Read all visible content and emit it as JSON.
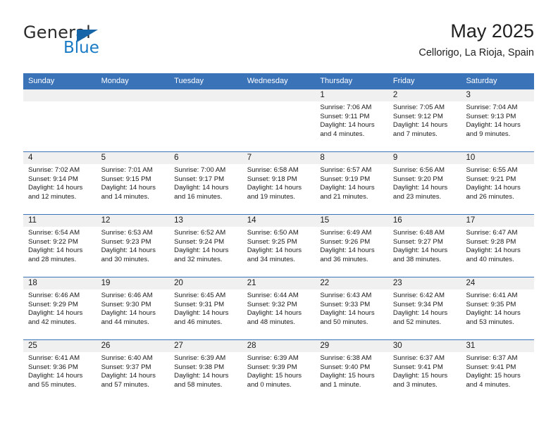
{
  "brand": {
    "name_part1": "General",
    "name_part2": "Blue",
    "flag_icon": "triangle-flag-icon"
  },
  "header": {
    "title": "May 2025",
    "subtitle": "Cellorigo, La Rioja, Spain"
  },
  "colors": {
    "header_blue": "#3b73b9",
    "daynum_band": "#f0f0f0",
    "brand_blue": "#1a7bc4",
    "flag_blue": "#1565a8"
  },
  "calendar": {
    "weekday_headers": [
      "Sunday",
      "Monday",
      "Tuesday",
      "Wednesday",
      "Thursday",
      "Friday",
      "Saturday"
    ],
    "weeks": [
      [
        {
          "day": "",
          "sunrise": "",
          "sunset": "",
          "daylight_line1": "",
          "daylight_line2": ""
        },
        {
          "day": "",
          "sunrise": "",
          "sunset": "",
          "daylight_line1": "",
          "daylight_line2": ""
        },
        {
          "day": "",
          "sunrise": "",
          "sunset": "",
          "daylight_line1": "",
          "daylight_line2": ""
        },
        {
          "day": "",
          "sunrise": "",
          "sunset": "",
          "daylight_line1": "",
          "daylight_line2": ""
        },
        {
          "day": "1",
          "sunrise": "Sunrise: 7:06 AM",
          "sunset": "Sunset: 9:11 PM",
          "daylight_line1": "Daylight: 14 hours",
          "daylight_line2": "and 4 minutes."
        },
        {
          "day": "2",
          "sunrise": "Sunrise: 7:05 AM",
          "sunset": "Sunset: 9:12 PM",
          "daylight_line1": "Daylight: 14 hours",
          "daylight_line2": "and 7 minutes."
        },
        {
          "day": "3",
          "sunrise": "Sunrise: 7:04 AM",
          "sunset": "Sunset: 9:13 PM",
          "daylight_line1": "Daylight: 14 hours",
          "daylight_line2": "and 9 minutes."
        }
      ],
      [
        {
          "day": "4",
          "sunrise": "Sunrise: 7:02 AM",
          "sunset": "Sunset: 9:14 PM",
          "daylight_line1": "Daylight: 14 hours",
          "daylight_line2": "and 12 minutes."
        },
        {
          "day": "5",
          "sunrise": "Sunrise: 7:01 AM",
          "sunset": "Sunset: 9:15 PM",
          "daylight_line1": "Daylight: 14 hours",
          "daylight_line2": "and 14 minutes."
        },
        {
          "day": "6",
          "sunrise": "Sunrise: 7:00 AM",
          "sunset": "Sunset: 9:17 PM",
          "daylight_line1": "Daylight: 14 hours",
          "daylight_line2": "and 16 minutes."
        },
        {
          "day": "7",
          "sunrise": "Sunrise: 6:58 AM",
          "sunset": "Sunset: 9:18 PM",
          "daylight_line1": "Daylight: 14 hours",
          "daylight_line2": "and 19 minutes."
        },
        {
          "day": "8",
          "sunrise": "Sunrise: 6:57 AM",
          "sunset": "Sunset: 9:19 PM",
          "daylight_line1": "Daylight: 14 hours",
          "daylight_line2": "and 21 minutes."
        },
        {
          "day": "9",
          "sunrise": "Sunrise: 6:56 AM",
          "sunset": "Sunset: 9:20 PM",
          "daylight_line1": "Daylight: 14 hours",
          "daylight_line2": "and 23 minutes."
        },
        {
          "day": "10",
          "sunrise": "Sunrise: 6:55 AM",
          "sunset": "Sunset: 9:21 PM",
          "daylight_line1": "Daylight: 14 hours",
          "daylight_line2": "and 26 minutes."
        }
      ],
      [
        {
          "day": "11",
          "sunrise": "Sunrise: 6:54 AM",
          "sunset": "Sunset: 9:22 PM",
          "daylight_line1": "Daylight: 14 hours",
          "daylight_line2": "and 28 minutes."
        },
        {
          "day": "12",
          "sunrise": "Sunrise: 6:53 AM",
          "sunset": "Sunset: 9:23 PM",
          "daylight_line1": "Daylight: 14 hours",
          "daylight_line2": "and 30 minutes."
        },
        {
          "day": "13",
          "sunrise": "Sunrise: 6:52 AM",
          "sunset": "Sunset: 9:24 PM",
          "daylight_line1": "Daylight: 14 hours",
          "daylight_line2": "and 32 minutes."
        },
        {
          "day": "14",
          "sunrise": "Sunrise: 6:50 AM",
          "sunset": "Sunset: 9:25 PM",
          "daylight_line1": "Daylight: 14 hours",
          "daylight_line2": "and 34 minutes."
        },
        {
          "day": "15",
          "sunrise": "Sunrise: 6:49 AM",
          "sunset": "Sunset: 9:26 PM",
          "daylight_line1": "Daylight: 14 hours",
          "daylight_line2": "and 36 minutes."
        },
        {
          "day": "16",
          "sunrise": "Sunrise: 6:48 AM",
          "sunset": "Sunset: 9:27 PM",
          "daylight_line1": "Daylight: 14 hours",
          "daylight_line2": "and 38 minutes."
        },
        {
          "day": "17",
          "sunrise": "Sunrise: 6:47 AM",
          "sunset": "Sunset: 9:28 PM",
          "daylight_line1": "Daylight: 14 hours",
          "daylight_line2": "and 40 minutes."
        }
      ],
      [
        {
          "day": "18",
          "sunrise": "Sunrise: 6:46 AM",
          "sunset": "Sunset: 9:29 PM",
          "daylight_line1": "Daylight: 14 hours",
          "daylight_line2": "and 42 minutes."
        },
        {
          "day": "19",
          "sunrise": "Sunrise: 6:46 AM",
          "sunset": "Sunset: 9:30 PM",
          "daylight_line1": "Daylight: 14 hours",
          "daylight_line2": "and 44 minutes."
        },
        {
          "day": "20",
          "sunrise": "Sunrise: 6:45 AM",
          "sunset": "Sunset: 9:31 PM",
          "daylight_line1": "Daylight: 14 hours",
          "daylight_line2": "and 46 minutes."
        },
        {
          "day": "21",
          "sunrise": "Sunrise: 6:44 AM",
          "sunset": "Sunset: 9:32 PM",
          "daylight_line1": "Daylight: 14 hours",
          "daylight_line2": "and 48 minutes."
        },
        {
          "day": "22",
          "sunrise": "Sunrise: 6:43 AM",
          "sunset": "Sunset: 9:33 PM",
          "daylight_line1": "Daylight: 14 hours",
          "daylight_line2": "and 50 minutes."
        },
        {
          "day": "23",
          "sunrise": "Sunrise: 6:42 AM",
          "sunset": "Sunset: 9:34 PM",
          "daylight_line1": "Daylight: 14 hours",
          "daylight_line2": "and 52 minutes."
        },
        {
          "day": "24",
          "sunrise": "Sunrise: 6:41 AM",
          "sunset": "Sunset: 9:35 PM",
          "daylight_line1": "Daylight: 14 hours",
          "daylight_line2": "and 53 minutes."
        }
      ],
      [
        {
          "day": "25",
          "sunrise": "Sunrise: 6:41 AM",
          "sunset": "Sunset: 9:36 PM",
          "daylight_line1": "Daylight: 14 hours",
          "daylight_line2": "and 55 minutes."
        },
        {
          "day": "26",
          "sunrise": "Sunrise: 6:40 AM",
          "sunset": "Sunset: 9:37 PM",
          "daylight_line1": "Daylight: 14 hours",
          "daylight_line2": "and 57 minutes."
        },
        {
          "day": "27",
          "sunrise": "Sunrise: 6:39 AM",
          "sunset": "Sunset: 9:38 PM",
          "daylight_line1": "Daylight: 14 hours",
          "daylight_line2": "and 58 minutes."
        },
        {
          "day": "28",
          "sunrise": "Sunrise: 6:39 AM",
          "sunset": "Sunset: 9:39 PM",
          "daylight_line1": "Daylight: 15 hours",
          "daylight_line2": "and 0 minutes."
        },
        {
          "day": "29",
          "sunrise": "Sunrise: 6:38 AM",
          "sunset": "Sunset: 9:40 PM",
          "daylight_line1": "Daylight: 15 hours",
          "daylight_line2": "and 1 minute."
        },
        {
          "day": "30",
          "sunrise": "Sunrise: 6:37 AM",
          "sunset": "Sunset: 9:41 PM",
          "daylight_line1": "Daylight: 15 hours",
          "daylight_line2": "and 3 minutes."
        },
        {
          "day": "31",
          "sunrise": "Sunrise: 6:37 AM",
          "sunset": "Sunset: 9:41 PM",
          "daylight_line1": "Daylight: 15 hours",
          "daylight_line2": "and 4 minutes."
        }
      ]
    ]
  }
}
